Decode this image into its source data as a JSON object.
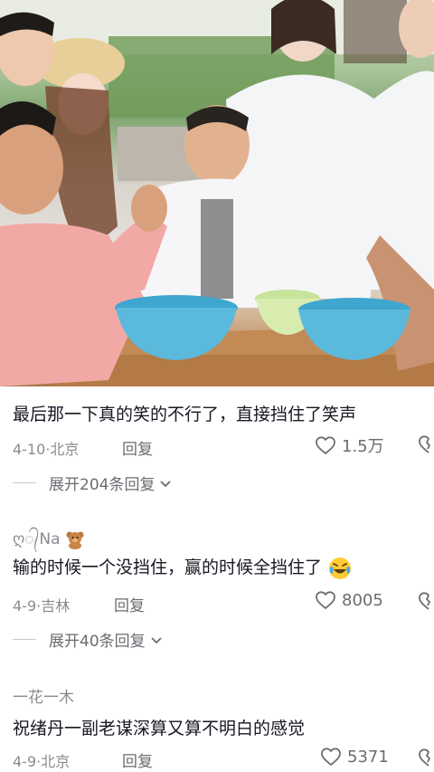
{
  "comments": [
    {
      "text": "最后那一下真的笑的不行了，直接挡住了笑声",
      "date": "4-10",
      "location": "北京",
      "reply_label": "回复",
      "likes": "1.5万",
      "expand_label": "展开204条回复"
    },
    {
      "username": "ღ᭄Na",
      "username_emoji": "teddy-bear-emoji",
      "text": "输的时候一个没挡住，赢的时候全挡住了",
      "text_emoji": "laughing-tears-emoji",
      "date": "4-9",
      "location": "吉林",
      "reply_label": "回复",
      "likes": "8005",
      "expand_label": "展开40条回复"
    },
    {
      "username": "一花一木",
      "text": "祝绪丹一副老谋深算又算不明白的感觉",
      "date": "4-9",
      "location": "北京",
      "reply_label": "回复",
      "likes": "5371"
    }
  ],
  "icons": {
    "like": "heart-outline-icon",
    "dislike": "broken-heart-icon",
    "expand": "chevron-down-icon"
  },
  "colors": {
    "text": "#161823",
    "meta": "#8a8b91",
    "basin_blue": "#5bb9dc"
  }
}
